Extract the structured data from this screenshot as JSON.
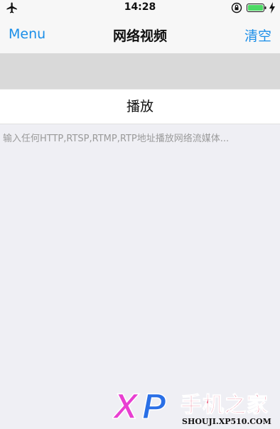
{
  "status_bar": {
    "time": "14:28",
    "icons": [
      "airplane-icon",
      "orientation-lock-icon",
      "battery-icon",
      "charging-icon"
    ],
    "battery_color": "#4cd964"
  },
  "nav": {
    "left_label": "Menu",
    "title": "网络视频",
    "right_label": "清空",
    "accent_color": "#1a8ee8"
  },
  "form": {
    "url_value": "",
    "play_label": "播放",
    "hint": "输入任何HTTP,RTSP,RTMP,RTP地址播放网络流媒体..."
  },
  "watermark": {
    "logo_text": "XP",
    "brand": "手机之家",
    "url": "SHOUJI.XP510.COM"
  }
}
